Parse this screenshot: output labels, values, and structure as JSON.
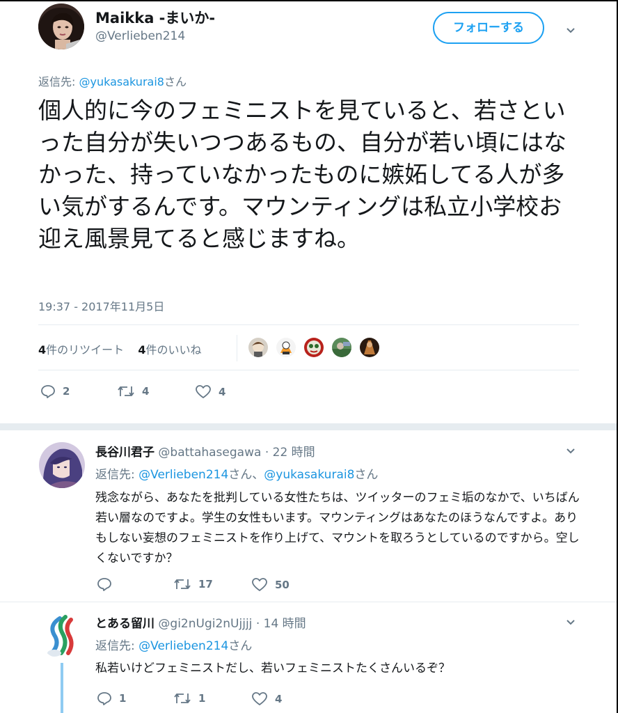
{
  "main_tweet": {
    "name": "Maikka -まいか-",
    "handle": "@Verlieben214",
    "follow_label": "フォローする",
    "reply_prefix": "返信先: ",
    "reply_to": "@yukasakurai8",
    "reply_suffix": "さん",
    "text": "個人的に今のフェミニストを見ていると、若さといった自分が失いつつあるもの、自分が若い頃にはなかった、持っていなかったものに嫉妬してる人が多い気がするんです。マウンティングは私立小学校お迎え風景見てると感じますね。",
    "timestamp": "19:37 - 2017年11月5日",
    "retweets_count": "4",
    "retweets_label": "件のリツイート",
    "likes_count": "4",
    "likes_label": "件のいいね",
    "actions": {
      "replies": "2",
      "retweets": "4",
      "likes": "4"
    }
  },
  "replies": [
    {
      "name": "長谷川君子",
      "handle": "@battahasegawa",
      "sep": "·",
      "time": "22 時間",
      "reply_prefix": "返信先: ",
      "reply_to_1": "@Verlieben214",
      "reply_mid": "さん、",
      "reply_to_2": "@yukasakurai8",
      "reply_suffix": "さん",
      "text": "残念ながら、あなたを批判している女性たちは、ツイッターのフェミ垢のなかで、いちばん若い層なのですよ。学生の女性もいます。マウンティングはあなたのほうなんですよ。ありもしない妄想のフェミニストを作り上げて、マウントを取ろうとしているのですから。空しくないですか？",
      "actions": {
        "replies": "",
        "retweets": "17",
        "likes": "50"
      }
    },
    {
      "name": "とある留川",
      "handle": "@gi2nUgi2nUjjjj",
      "sep": "·",
      "time": "14 時間",
      "reply_prefix": "返信先: ",
      "reply_to_1": "@Verlieben214",
      "reply_suffix": "さん",
      "text": "私若いけどフェミニストだし、若いフェミニストたくさんいるぞ？",
      "actions": {
        "replies": "1",
        "retweets": "1",
        "likes": "4"
      }
    }
  ],
  "icons": [
    "chevron-down-icon",
    "reply-icon",
    "retweet-icon",
    "heart-icon"
  ],
  "colors": {
    "accent": "#1da1f2",
    "link": "#1b95e0",
    "muted": "#657786",
    "divider": "#e6ecf0"
  }
}
